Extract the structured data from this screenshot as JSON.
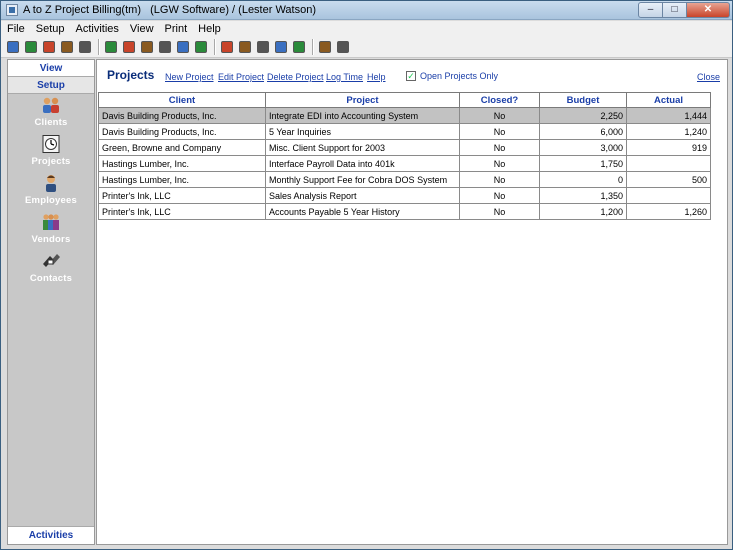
{
  "window": {
    "title": "A to Z Project Billing(tm)   (LGW Software) / (Lester Watson)",
    "controls": {
      "minimize": "–",
      "maximize": "□",
      "close": "✕"
    }
  },
  "menu": [
    "File",
    "Setup",
    "Activities",
    "View",
    "Print",
    "Help"
  ],
  "toolbar": {
    "groups": [
      [
        "clients-icon",
        "projects-icon",
        "employees-icon",
        "vendors-icon",
        "contacts-icon"
      ],
      [
        "timer-icon",
        "calendar-icon",
        "invoice-icon",
        "report-icon",
        "ledger-icon",
        "list-icon"
      ],
      [
        "home-icon",
        "grid-icon",
        "schedule-icon",
        "preview-icon",
        "window-icon"
      ],
      [
        "help-icon",
        "exit-icon"
      ]
    ]
  },
  "sidebar": {
    "view_label": "View",
    "setup_label": "Setup",
    "items": [
      {
        "name": "clients",
        "label": "Clients",
        "icon": "clients-icon"
      },
      {
        "name": "projects",
        "label": "Projects",
        "icon": "clock-icon"
      },
      {
        "name": "employees",
        "label": "Employees",
        "icon": "employee-icon"
      },
      {
        "name": "vendors",
        "label": "Vendors",
        "icon": "vendors-icon"
      },
      {
        "name": "contacts",
        "label": "Contacts",
        "icon": "contacts-icon"
      }
    ],
    "activities_label": "Activities"
  },
  "main": {
    "title": "Projects",
    "links": {
      "new": "New Project",
      "edit": "Edit Project",
      "delete": "Delete Project",
      "log": "Log Time",
      "help": "Help",
      "close": "Close"
    },
    "filter": {
      "label": "Open Projects Only",
      "checked": true
    },
    "columns": [
      "Client",
      "Project",
      "Closed?",
      "Budget",
      "Actual"
    ],
    "rows": [
      {
        "client": "Davis Building Products, Inc.",
        "project": "Integrate EDI into Accounting System",
        "closed": "No",
        "budget": "2,250",
        "actual": "1,444",
        "selected": true
      },
      {
        "client": "Davis Building Products, Inc.",
        "project": "5 Year Inquiries",
        "closed": "No",
        "budget": "6,000",
        "actual": "1,240"
      },
      {
        "client": "Green, Browne and Company",
        "project": "Misc. Client Support for 2003",
        "closed": "No",
        "budget": "3,000",
        "actual": "919"
      },
      {
        "client": "Hastings Lumber, Inc.",
        "project": "Interface Payroll Data into 401k",
        "closed": "No",
        "budget": "1,750",
        "actual": ""
      },
      {
        "client": "Hastings Lumber, Inc.",
        "project": "Monthly Support Fee for Cobra DOS System",
        "closed": "No",
        "budget": "0",
        "actual": "500"
      },
      {
        "client": "Printer's Ink, LLC",
        "project": "Sales Analysis Report",
        "closed": "No",
        "budget": "1,350",
        "actual": ""
      },
      {
        "client": "Printer's Ink, LLC",
        "project": "Accounts Payable 5 Year History",
        "closed": "No",
        "budget": "1,200",
        "actual": "1,260"
      }
    ]
  }
}
